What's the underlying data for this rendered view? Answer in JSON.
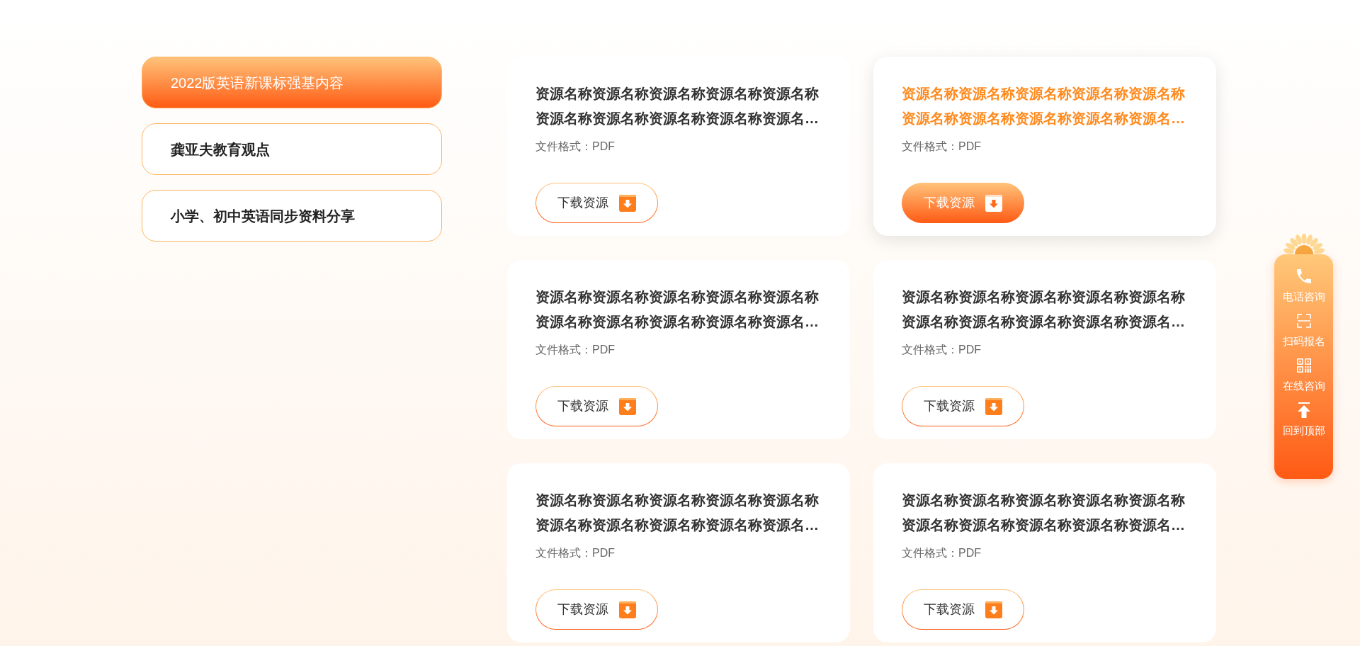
{
  "sidebar": {
    "items": [
      {
        "label": "2022版英语新课标强基内容",
        "selected": true
      },
      {
        "label": "龚亚夫教育观点",
        "selected": false
      },
      {
        "label": "小学、初中英语同步资料分享",
        "selected": false
      }
    ]
  },
  "resources": [
    {
      "title": "资源名称资源名称资源名称资源名称资源名称资源名称资源名称资源名称资源名称资源名…",
      "format": "文件格式：PDF",
      "button": "下载资源",
      "hovered": false
    },
    {
      "title": "资源名称资源名称资源名称资源名称资源名称资源名称资源名称资源名称资源名称资源名…",
      "format": "文件格式：PDF",
      "button": "下载资源",
      "hovered": true
    },
    {
      "title": "资源名称资源名称资源名称资源名称资源名称资源名称资源名称资源名称资源名称资源名…",
      "format": "文件格式：PDF",
      "button": "下载资源",
      "hovered": false
    },
    {
      "title": "资源名称资源名称资源名称资源名称资源名称资源名称资源名称资源名称资源名称资源名…",
      "format": "文件格式：PDF",
      "button": "下载资源",
      "hovered": false
    },
    {
      "title": "资源名称资源名称资源名称资源名称资源名称资源名称资源名称资源名称资源名称资源名…",
      "format": "文件格式：PDF",
      "button": "下载资源",
      "hovered": false
    },
    {
      "title": "资源名称资源名称资源名称资源名称资源名称资源名称资源名称资源名称资源名称资源名…",
      "format": "文件格式：PDF",
      "button": "下载资源",
      "hovered": false
    }
  ],
  "float_bar": {
    "items": [
      {
        "kind": "phone",
        "label": "电话咨询"
      },
      {
        "kind": "scan",
        "label": "扫码报名"
      },
      {
        "kind": "qrcode",
        "label": "在线咨询"
      },
      {
        "kind": "top",
        "label": "回到顶部"
      }
    ]
  }
}
